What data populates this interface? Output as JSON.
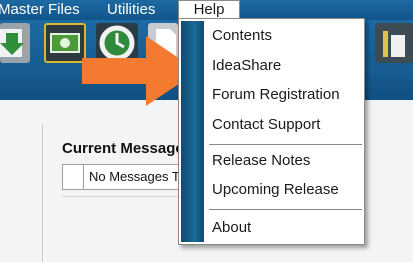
{
  "menubar": {
    "items": [
      {
        "label": "Master Files"
      },
      {
        "label": "Utilities"
      },
      {
        "label": "Help"
      }
    ]
  },
  "help_menu": {
    "items": [
      {
        "label": "Contents"
      },
      {
        "label": "IdeaShare"
      },
      {
        "label": "Forum Registration"
      },
      {
        "label": "Contact Support"
      },
      {
        "label": "Release Notes"
      },
      {
        "label": "Upcoming Release"
      },
      {
        "label": "About"
      }
    ]
  },
  "messages": {
    "title": "Current Message",
    "empty_text": "No Messages To Display"
  },
  "colors": {
    "menubar": "#1565a0",
    "toolbar": "#1c6aa4",
    "menu_stripe": "#1a6a98",
    "arrow": "#f47a2f"
  },
  "icons": {
    "toolbar": [
      "download-icon",
      "money-icon",
      "clock-icon",
      "document-icon",
      "chart-icon"
    ],
    "pointer": "arrow-right-icon"
  }
}
